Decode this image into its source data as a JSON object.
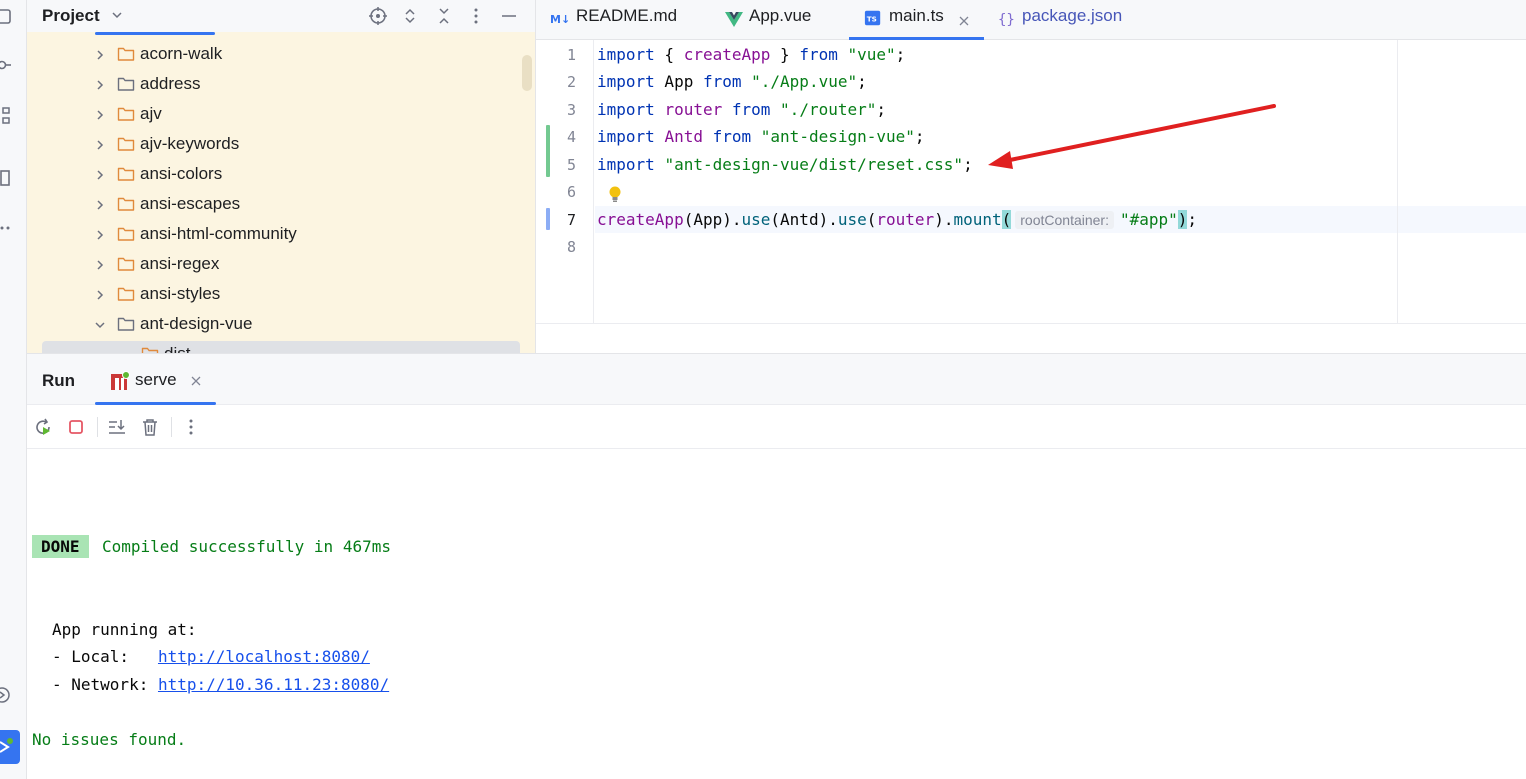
{
  "project_pane": {
    "title": "Project",
    "tree_items": [
      {
        "label": "acorn-walk",
        "expanded": false
      },
      {
        "label": "address",
        "expanded": false
      },
      {
        "label": "ajv",
        "expanded": false
      },
      {
        "label": "ajv-keywords",
        "expanded": false
      },
      {
        "label": "ansi-colors",
        "expanded": false
      },
      {
        "label": "ansi-escapes",
        "expanded": false
      },
      {
        "label": "ansi-html-community",
        "expanded": false
      },
      {
        "label": "ansi-regex",
        "expanded": false
      },
      {
        "label": "ansi-styles",
        "expanded": false
      },
      {
        "label": "ant-design-vue",
        "expanded": true
      },
      {
        "label": "dist",
        "expanded": false
      }
    ]
  },
  "editor_tabs": [
    {
      "label": "README.md",
      "icon": "markdown-icon",
      "active": false
    },
    {
      "label": "App.vue",
      "icon": "vue-icon",
      "active": false
    },
    {
      "label": "main.ts",
      "icon": "typescript-icon",
      "active": true
    },
    {
      "label": "package.json",
      "icon": "json-icon",
      "active": false
    }
  ],
  "editor": {
    "line_numbers": [
      "1",
      "2",
      "3",
      "4",
      "5",
      "6",
      "7",
      "8"
    ],
    "lines": {
      "l1": {
        "k1": "import",
        "p1": " { ",
        "v1": "createApp",
        "p2": " } ",
        "k2": "from",
        "p3": " ",
        "s1": "\"vue\"",
        "p4": ";"
      },
      "l2": {
        "k1": "import",
        "p1": " App ",
        "k2": "from",
        "p2": " ",
        "s1": "\"./App.vue\"",
        "p3": ";"
      },
      "l3": {
        "k1": "import",
        "p1": " ",
        "v1": "router",
        "p2": " ",
        "k2": "from",
        "p3": " ",
        "s1": "\"./router\"",
        "p4": ";"
      },
      "l4": {
        "k1": "import",
        "p1": " ",
        "v1": "Antd",
        "p2": " ",
        "k2": "from",
        "p3": " ",
        "s1": "\"ant-design-vue\"",
        "p4": ";"
      },
      "l5": {
        "k1": "import",
        "p1": " ",
        "s1": "\"ant-design-vue/dist/reset.css\"",
        "p2": ";"
      },
      "l7": {
        "v1": "createApp",
        "p1": "(App).",
        "f1": "use",
        "p2": "(Antd).",
        "f2": "use",
        "p3": "(",
        "v2": "router",
        "p4": ").",
        "f3": "mount",
        "b1": "(",
        "hint": "rootContainer:",
        "s1": "\"#app\"",
        "b2": ")",
        "p5": ";"
      }
    }
  },
  "run_panel": {
    "title": "Run",
    "tab_label": "serve"
  },
  "console": {
    "done": "DONE",
    "compiled": "Compiled successfully in 467ms",
    "app_running": "App running at:",
    "local_label": "- Local:   ",
    "local_url": "http://localhost:8080/",
    "network_label": "- Network: ",
    "network_url": "http://10.36.11.23:8080/",
    "no_issues": "No issues found."
  },
  "colors": {
    "accent": "#3574f0",
    "annotation_arrow": "#e02020",
    "done_badge": "#a9e4b4",
    "project_bg": "#fcf5e1"
  }
}
